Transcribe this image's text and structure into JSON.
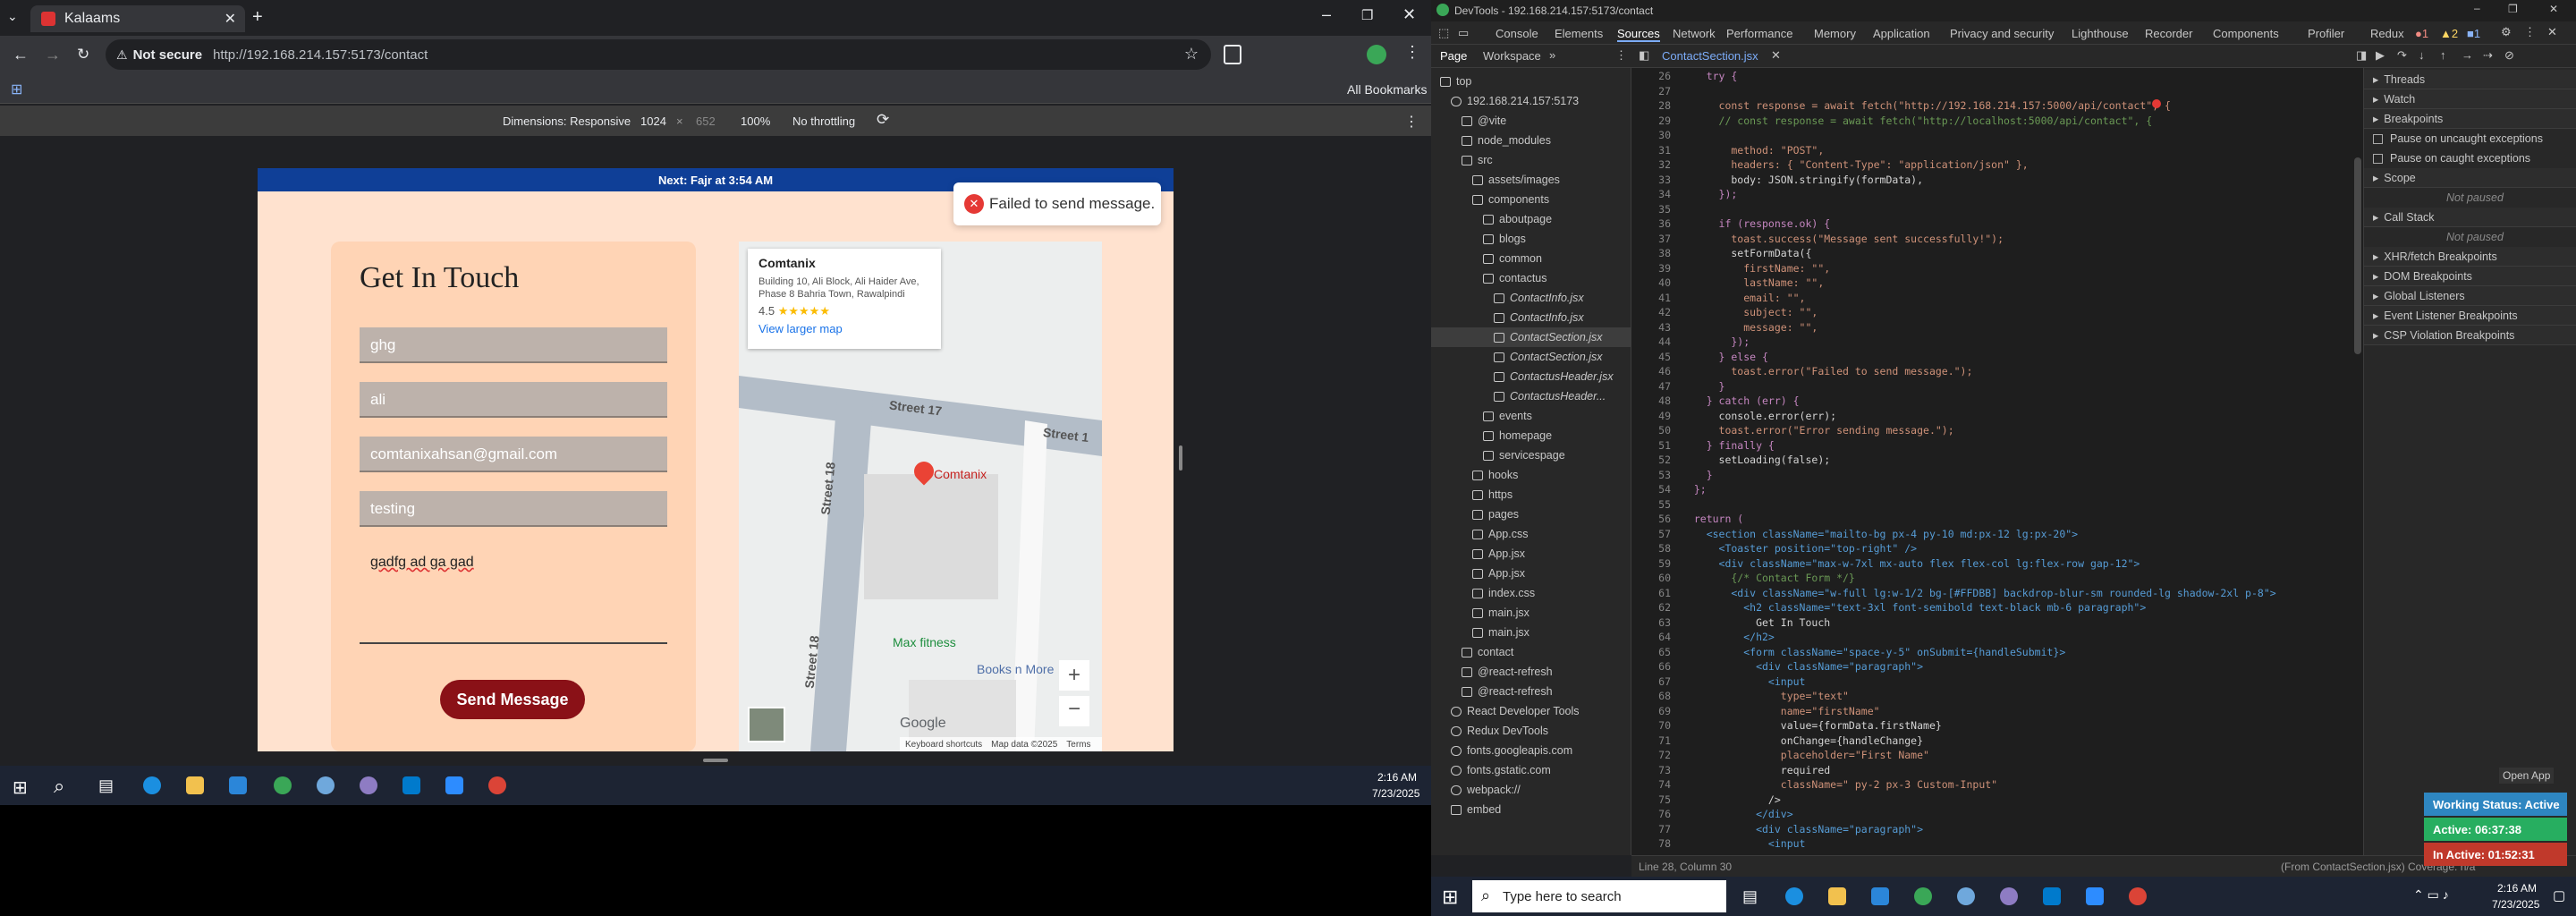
{
  "browser": {
    "tab_title": "Kalaams",
    "url_warning": "Not secure",
    "url": "http://192.168.214.157:5173/contact",
    "all_bookmarks": "All Bookmarks"
  },
  "devtoolbar": {
    "dimensions": "Dimensions: Responsive",
    "width": "1024",
    "height": "652",
    "zoom": "100%",
    "throttle": "No throttling"
  },
  "page": {
    "banner": "Next: Fajr at 3:54 AM",
    "heading": "Get In Touch",
    "fields": [
      "ghg",
      "ali",
      "comtanixahsan@gmail.com",
      "testing"
    ],
    "message": "gadfg ad ga gad",
    "send_button": "Send Message",
    "toast": "Failed to send message.",
    "map": {
      "place": "Comtanix",
      "address": "Building 10, Ali Block, Ali Haider Ave, Phase 8 Bahria Town, Rawalpindi",
      "rating": "4.5",
      "view_larger": "View larger map",
      "pin_label": "Comtanix",
      "street_a": "Street 17",
      "street_b": "Street 18",
      "street_c": "Street 18",
      "street_d": "Street 1",
      "poi_a": "Max fitness",
      "poi_b": "Books n More",
      "google": "Google",
      "shortcuts": "Keyboard shortcuts",
      "mapdata": "Map data ©2025",
      "terms": "Terms"
    }
  },
  "left_clock": {
    "time": "2:16 AM",
    "date": "7/23/2025"
  },
  "devtools": {
    "title": "DevTools - 192.168.214.157:5173/contact",
    "tabs": [
      "Console",
      "Elements",
      "Sources",
      "Network",
      "Performance",
      "Memory",
      "Application",
      "Privacy and security",
      "Lighthouse",
      "Recorder",
      "Components",
      "Profiler",
      "Redux"
    ],
    "error_counts": {
      "errors": "1",
      "warnings": "2",
      "issues": "1"
    },
    "panel_tabs": [
      "Page",
      "Workspace"
    ],
    "file_tab": "ContactSection.jsx",
    "tree": [
      {
        "label": "top",
        "indent": 0,
        "kind": "folder"
      },
      {
        "label": "192.168.214.157:5173",
        "indent": 1,
        "kind": "cloud"
      },
      {
        "label": "@vite",
        "indent": 2,
        "kind": "folder"
      },
      {
        "label": "node_modules",
        "indent": 2,
        "kind": "folder"
      },
      {
        "label": "src",
        "indent": 2,
        "kind": "folder"
      },
      {
        "label": "assets/images",
        "indent": 3,
        "kind": "folder"
      },
      {
        "label": "components",
        "indent": 3,
        "kind": "folder"
      },
      {
        "label": "aboutpage",
        "indent": 4,
        "kind": "folder"
      },
      {
        "label": "blogs",
        "indent": 4,
        "kind": "folder"
      },
      {
        "label": "common",
        "indent": 4,
        "kind": "folder"
      },
      {
        "label": "contactus",
        "indent": 4,
        "kind": "folder"
      },
      {
        "label": "ContactInfo.jsx",
        "indent": 5,
        "kind": "file"
      },
      {
        "label": "ContactInfo.jsx",
        "indent": 5,
        "kind": "file"
      },
      {
        "label": "ContactSection.jsx",
        "indent": 5,
        "kind": "file",
        "selected": true
      },
      {
        "label": "ContactSection.jsx",
        "indent": 5,
        "kind": "file"
      },
      {
        "label": "ContactusHeader.jsx",
        "indent": 5,
        "kind": "file"
      },
      {
        "label": "ContactusHeader...",
        "indent": 5,
        "kind": "file"
      },
      {
        "label": "events",
        "indent": 4,
        "kind": "folder"
      },
      {
        "label": "homepage",
        "indent": 4,
        "kind": "folder"
      },
      {
        "label": "servicespage",
        "indent": 4,
        "kind": "folder"
      },
      {
        "label": "hooks",
        "indent": 3,
        "kind": "folder"
      },
      {
        "label": "https",
        "indent": 3,
        "kind": "folder"
      },
      {
        "label": "pages",
        "indent": 3,
        "kind": "folder"
      },
      {
        "label": "App.css",
        "indent": 3,
        "kind": "file"
      },
      {
        "label": "App.jsx",
        "indent": 3,
        "kind": "file"
      },
      {
        "label": "App.jsx",
        "indent": 3,
        "kind": "file"
      },
      {
        "label": "index.css",
        "indent": 3,
        "kind": "file"
      },
      {
        "label": "main.jsx",
        "indent": 3,
        "kind": "file"
      },
      {
        "label": "main.jsx",
        "indent": 3,
        "kind": "file"
      },
      {
        "label": "contact",
        "indent": 2,
        "kind": "file"
      },
      {
        "label": "@react-refresh",
        "indent": 2,
        "kind": "file"
      },
      {
        "label": "@react-refresh",
        "indent": 2,
        "kind": "file"
      },
      {
        "label": "React Developer Tools",
        "indent": 1,
        "kind": "cloud"
      },
      {
        "label": "Redux DevTools",
        "indent": 1,
        "kind": "cloud"
      },
      {
        "label": "fonts.googleapis.com",
        "indent": 1,
        "kind": "cloud"
      },
      {
        "label": "fonts.gstatic.com",
        "indent": 1,
        "kind": "cloud"
      },
      {
        "label": "webpack://",
        "indent": 1,
        "kind": "cloud"
      },
      {
        "label": "embed",
        "indent": 1,
        "kind": "folder"
      }
    ],
    "code": [
      {
        "n": "26",
        "t": "    try {"
      },
      {
        "n": "27",
        "t": ""
      },
      {
        "n": "28",
        "t": "      const response = await fetch(\"http://192.168.214.157:5000/api/contact\", {"
      },
      {
        "n": "29",
        "t": "      // const response = await fetch(\"http://localhost:5000/api/contact\", {"
      },
      {
        "n": "30",
        "t": ""
      },
      {
        "n": "31",
        "t": "        method: \"POST\","
      },
      {
        "n": "32",
        "t": "        headers: { \"Content-Type\": \"application/json\" },"
      },
      {
        "n": "33",
        "t": "        body: JSON.stringify(formData),"
      },
      {
        "n": "34",
        "t": "      });"
      },
      {
        "n": "35",
        "t": ""
      },
      {
        "n": "36",
        "t": "      if (response.ok) {"
      },
      {
        "n": "37",
        "t": "        toast.success(\"Message sent successfully!\");"
      },
      {
        "n": "38",
        "t": "        setFormData({"
      },
      {
        "n": "39",
        "t": "          firstName: \"\","
      },
      {
        "n": "40",
        "t": "          lastName: \"\","
      },
      {
        "n": "41",
        "t": "          email: \"\","
      },
      {
        "n": "42",
        "t": "          subject: \"\","
      },
      {
        "n": "43",
        "t": "          message: \"\","
      },
      {
        "n": "44",
        "t": "        });"
      },
      {
        "n": "45",
        "t": "      } else {"
      },
      {
        "n": "46",
        "t": "        toast.error(\"Failed to send message.\");"
      },
      {
        "n": "47",
        "t": "      }"
      },
      {
        "n": "48",
        "t": "    } catch (err) {"
      },
      {
        "n": "49",
        "t": "      console.error(err);"
      },
      {
        "n": "50",
        "t": "      toast.error(\"Error sending message.\");"
      },
      {
        "n": "51",
        "t": "    } finally {"
      },
      {
        "n": "52",
        "t": "      setLoading(false);"
      },
      {
        "n": "53",
        "t": "    }"
      },
      {
        "n": "54",
        "t": "  };"
      },
      {
        "n": "55",
        "t": ""
      },
      {
        "n": "56",
        "t": "  return ("
      },
      {
        "n": "57",
        "t": "    <section className=\"mailto-bg px-4 py-10 md:px-12 lg:px-20\">"
      },
      {
        "n": "58",
        "t": "      <Toaster position=\"top-right\" />"
      },
      {
        "n": "59",
        "t": "      <div className=\"max-w-7xl mx-auto flex flex-col lg:flex-row gap-12\">"
      },
      {
        "n": "60",
        "t": "        {/* Contact Form */}"
      },
      {
        "n": "61",
        "t": "        <div className=\"w-full lg:w-1/2 bg-[#FFDBB] backdrop-blur-sm rounded-lg shadow-2xl p-8\">"
      },
      {
        "n": "62",
        "t": "          <h2 className=\"text-3xl font-semibold text-black mb-6 paragraph\">"
      },
      {
        "n": "63",
        "t": "            Get In Touch"
      },
      {
        "n": "64",
        "t": "          </h2>"
      },
      {
        "n": "65",
        "t": "          <form className=\"space-y-5\" onSubmit={handleSubmit}>"
      },
      {
        "n": "66",
        "t": "            <div className=\"paragraph\">"
      },
      {
        "n": "67",
        "t": "              <input"
      },
      {
        "n": "68",
        "t": "                type=\"text\""
      },
      {
        "n": "69",
        "t": "                name=\"firstName\""
      },
      {
        "n": "70",
        "t": "                value={formData.firstName}"
      },
      {
        "n": "71",
        "t": "                onChange={handleChange}"
      },
      {
        "n": "72",
        "t": "                placeholder=\"First Name\""
      },
      {
        "n": "73",
        "t": "                required"
      },
      {
        "n": "74",
        "t": "                className=\" py-2 px-3 Custom-Input\""
      },
      {
        "n": "75",
        "t": "              />"
      },
      {
        "n": "76",
        "t": "            </div>"
      },
      {
        "n": "77",
        "t": "            <div className=\"paragraph\">"
      },
      {
        "n": "78",
        "t": "              <input"
      }
    ],
    "sidebar": [
      {
        "label": "Threads",
        "hdr": true
      },
      {
        "label": "Watch",
        "hdr": true
      },
      {
        "label": "Breakpoints",
        "hdr": true
      },
      {
        "label": "Pause on uncaught exceptions",
        "check": true
      },
      {
        "label": "Pause on caught exceptions",
        "check": true
      },
      {
        "label": "Scope",
        "hdr": true
      },
      {
        "label": "Not paused",
        "muted": true
      },
      {
        "label": "Call Stack",
        "hdr": true
      },
      {
        "label": "Not paused",
        "muted": true
      },
      {
        "label": "XHR/fetch Breakpoints",
        "hdr": true
      },
      {
        "label": "DOM Breakpoints",
        "hdr": true
      },
      {
        "label": "Global Listeners",
        "hdr": true
      },
      {
        "label": "Event Listener Breakpoints",
        "hdr": true
      },
      {
        "label": "CSP Violation Breakpoints",
        "hdr": true
      }
    ],
    "status_left": "Line 28, Column 30",
    "status_from": "(From ContactSection.jsx)",
    "status_coverage": "Coverage: n/a"
  },
  "tracker": {
    "open_app": "Open App",
    "working": "Working Status: Active",
    "active": "Active: 06:37:38",
    "inactive": "In Active: 01:52:31"
  },
  "right_taskbar": {
    "search": "Type here to search",
    "time": "2:16 AM",
    "date": "7/23/2025"
  }
}
